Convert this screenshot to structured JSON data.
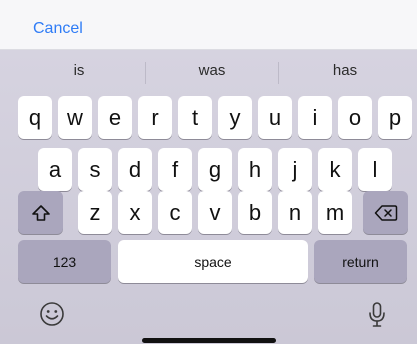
{
  "toolbar": {
    "cancel_label": "Cancel"
  },
  "suggestions": [
    "is",
    "was",
    "has"
  ],
  "keyboard": {
    "row1": [
      "q",
      "w",
      "e",
      "r",
      "t",
      "y",
      "u",
      "i",
      "o",
      "p"
    ],
    "row2": [
      "a",
      "s",
      "d",
      "f",
      "g",
      "h",
      "j",
      "k",
      "l"
    ],
    "row3": [
      "z",
      "x",
      "c",
      "v",
      "b",
      "n",
      "m"
    ],
    "numbers_label": "123",
    "space_label": "space",
    "return_label": "return"
  },
  "icons": {
    "shift": "shift-icon",
    "delete": "delete-icon",
    "emoji": "emoji-icon",
    "mic": "microphone-icon"
  },
  "colors": {
    "accent": "#2f7cf6",
    "keyboard_bg": "#d6d3e0",
    "function_key": "#aaa6bd",
    "key": "#ffffff"
  }
}
